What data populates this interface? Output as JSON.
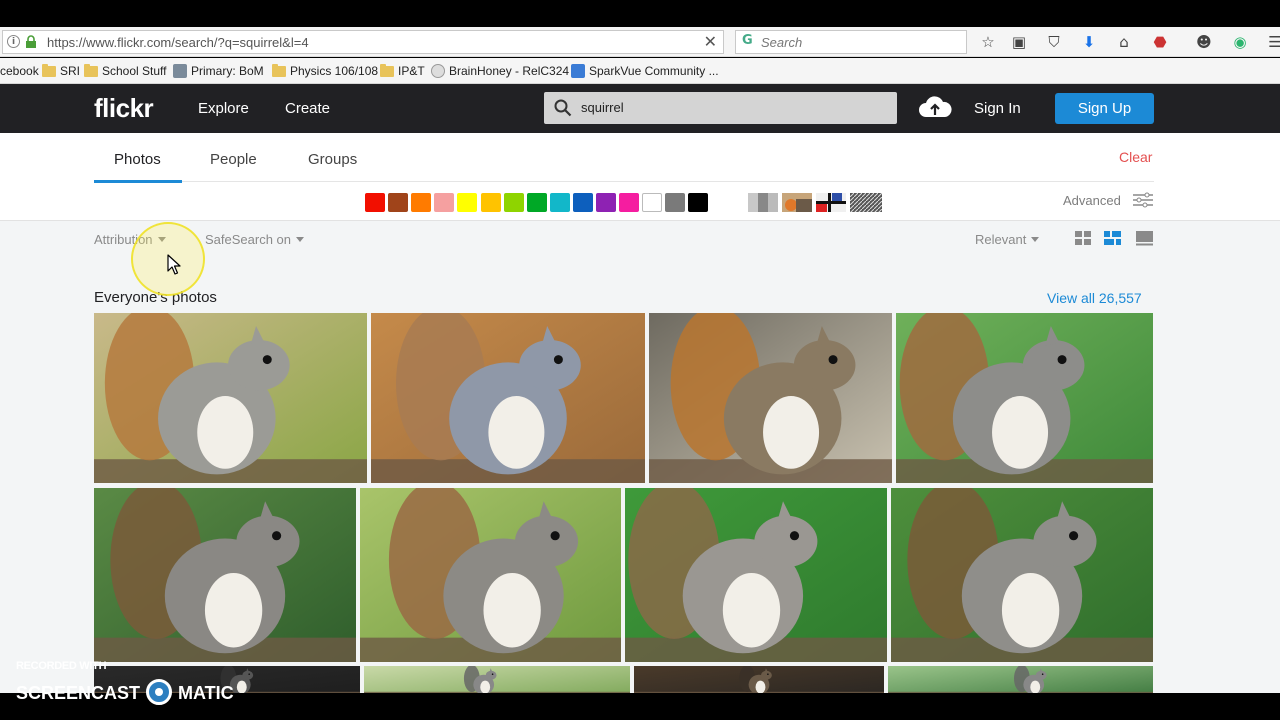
{
  "browser": {
    "url": "https://www.flickr.com/search/?q=squirrel&l=4",
    "search_placeholder": "Search",
    "icons": [
      "star-icon",
      "reader-icon",
      "pocket-icon",
      "download-icon",
      "home-icon",
      "adblock-icon",
      "chat-icon",
      "grammarly-icon",
      "menu-icon"
    ],
    "bookmarks": [
      "cebook",
      "SRI",
      "School Stuff",
      "Primary: BoM",
      "Physics 106/108",
      "IP&T",
      "BrainHoney - RelC324",
      "SparkVue Community ..."
    ]
  },
  "header": {
    "logo": "flickr",
    "explore": "Explore",
    "create": "Create",
    "search_value": "squirrel",
    "sign_in": "Sign In",
    "sign_up": "Sign Up"
  },
  "tabs": {
    "items": [
      "Photos",
      "People",
      "Groups"
    ],
    "active": "Photos",
    "clear": "Clear"
  },
  "colors": {
    "swatches": [
      "#f20f00",
      "#a0441a",
      "#ff7b00",
      "#f5a0a0",
      "#ffff00",
      "#ffc300",
      "#8fd400",
      "#00a826",
      "#12b7c9",
      "#0d5fbd",
      "#8e22b3",
      "#f51da0",
      "#ffffff",
      "#7a7a7a",
      "#000000"
    ],
    "styles": [
      "black-and-white",
      "shallow-depth-of-field",
      "minimalist",
      "patterns"
    ],
    "accent": "#1c8ad6",
    "clear_color": "#e45050"
  },
  "advanced": "Advanced",
  "filters": {
    "attribution": "Attribution",
    "safesearch": "SafeSearch on",
    "sort": "Relevant",
    "views": [
      "grid-small-view",
      "justified-view",
      "large-view"
    ],
    "active_view": "justified-view"
  },
  "section": {
    "title": "Everyone's photos",
    "view_all": "View all 26,557"
  },
  "watermark": {
    "line1": "RECORDED WITH",
    "word1": "SCREENCAST",
    "word2": "MATIC"
  }
}
